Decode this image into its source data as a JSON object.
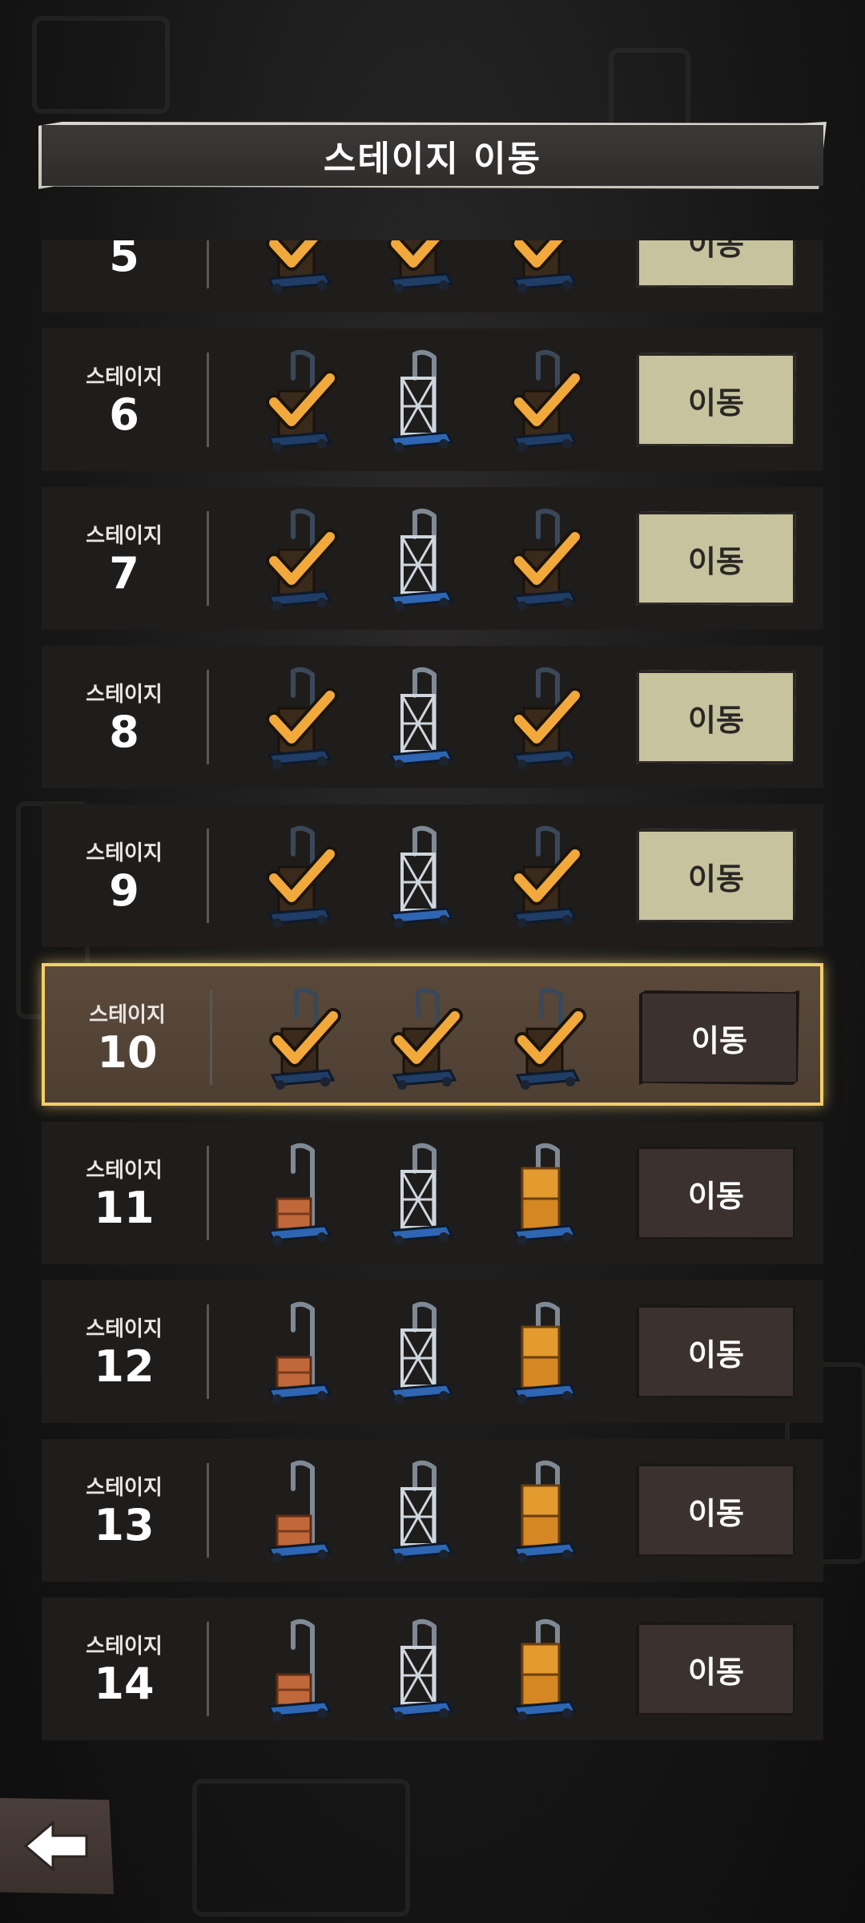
{
  "header": {
    "title": "스테이지 이동"
  },
  "stage_word": "스테이지",
  "move_label": "이동",
  "stages": [
    {
      "number": "5",
      "state": "cleared",
      "current": false,
      "items": [
        "cleared",
        "cleared",
        "cleared"
      ]
    },
    {
      "number": "6",
      "state": "cleared",
      "current": false,
      "items": [
        "cleared",
        "empty",
        "cleared"
      ]
    },
    {
      "number": "7",
      "state": "cleared",
      "current": false,
      "items": [
        "cleared",
        "empty",
        "cleared"
      ]
    },
    {
      "number": "8",
      "state": "cleared",
      "current": false,
      "items": [
        "cleared",
        "empty",
        "cleared"
      ]
    },
    {
      "number": "9",
      "state": "cleared",
      "current": false,
      "items": [
        "cleared",
        "empty",
        "cleared"
      ]
    },
    {
      "number": "10",
      "state": "current",
      "current": true,
      "items": [
        "cleared",
        "cleared",
        "cleared"
      ]
    },
    {
      "number": "11",
      "state": "locked",
      "current": false,
      "items": [
        "small-crate",
        "empty",
        "stacked-crates"
      ]
    },
    {
      "number": "12",
      "state": "locked",
      "current": false,
      "items": [
        "small-crate",
        "empty",
        "stacked-crates"
      ]
    },
    {
      "number": "13",
      "state": "locked",
      "current": false,
      "items": [
        "small-crate",
        "empty",
        "stacked-crates"
      ]
    },
    {
      "number": "14",
      "state": "locked",
      "current": false,
      "items": [
        "small-crate",
        "empty",
        "stacked-crates"
      ]
    }
  ],
  "icons": {
    "cart": "hand-truck-icon",
    "check": "checkmark-icon",
    "back": "back-arrow-icon"
  },
  "colors": {
    "check": "#f2a93b",
    "highlight_border": "#f3cf6a",
    "unlocked_button": "#c7c39f",
    "locked_button": "#3b3230"
  }
}
